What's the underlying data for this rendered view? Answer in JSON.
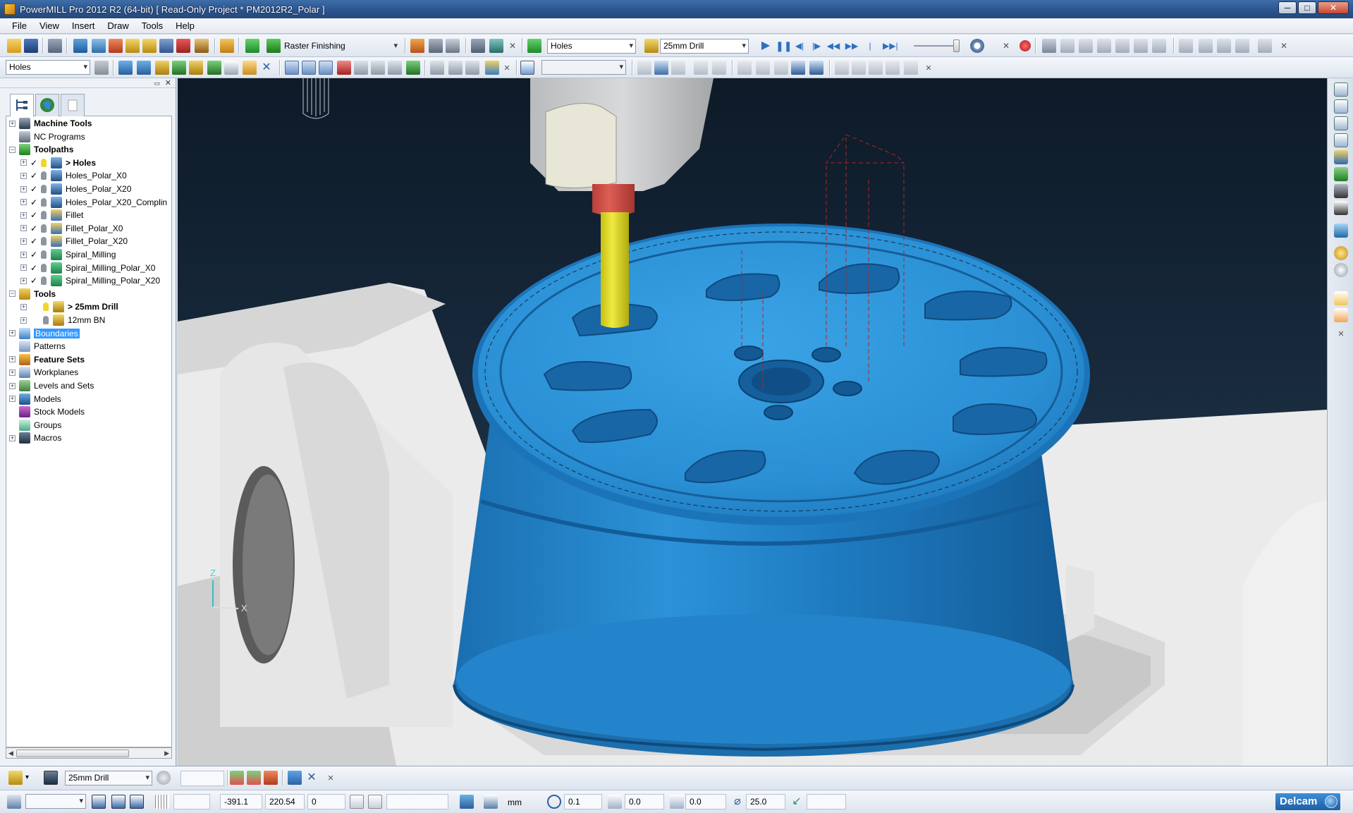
{
  "window": {
    "title": "PowerMILL Pro 2012 R2 (64-bit)    [ Read-Only Project * PM2012R2_Polar ]",
    "minimize": "─",
    "maximize": "□",
    "close": "✕"
  },
  "menu": {
    "items": [
      "File",
      "View",
      "Insert",
      "Draw",
      "Tools",
      "Help"
    ]
  },
  "toolbar1": {
    "strategy_combo": "Raster Finishing",
    "toolpath_combo": "Holes",
    "tool_combo": "25mm Drill"
  },
  "toolbar2": {
    "featureset_combo": "Holes",
    "empty_combo": ""
  },
  "explorer": {
    "tree": [
      {
        "label": "Machine Tools",
        "bold": true,
        "level": 0,
        "icon": "machine-tool-icon",
        "expander": "+"
      },
      {
        "label": "NC Programs",
        "bold": false,
        "level": 0,
        "icon": "nc-program-icon",
        "expander": ""
      },
      {
        "label": "Toolpaths",
        "bold": true,
        "level": 0,
        "icon": "toolpath-icon",
        "expander": "−"
      },
      {
        "label": "> Holes",
        "bold": true,
        "level": 1,
        "icon": "drill-toolpath-icon",
        "checked": "✓",
        "bulb": true,
        "expander": "+"
      },
      {
        "label": "Holes_Polar_X0",
        "bold": false,
        "level": 1,
        "icon": "drill-toolpath-icon",
        "checked": "✓",
        "bulb": false,
        "expander": "+"
      },
      {
        "label": "Holes_Polar_X20",
        "bold": false,
        "level": 1,
        "icon": "drill-toolpath-icon",
        "checked": "✓",
        "bulb": false,
        "expander": "+"
      },
      {
        "label": "Holes_Polar_X20_Complin",
        "bold": false,
        "level": 1,
        "icon": "drill-toolpath-icon",
        "checked": "✓",
        "bulb": false,
        "expander": "+"
      },
      {
        "label": "Fillet",
        "bold": false,
        "level": 1,
        "icon": "fillet-toolpath-icon",
        "checked": "✓",
        "bulb": false,
        "expander": "+"
      },
      {
        "label": "Fillet_Polar_X0",
        "bold": false,
        "level": 1,
        "icon": "fillet-toolpath-icon",
        "checked": "✓",
        "bulb": false,
        "expander": "+"
      },
      {
        "label": "Fillet_Polar_X20",
        "bold": false,
        "level": 1,
        "icon": "fillet-toolpath-icon",
        "checked": "✓",
        "bulb": false,
        "expander": "+"
      },
      {
        "label": "Spiral_Milling",
        "bold": false,
        "level": 1,
        "icon": "spiral-toolpath-icon",
        "checked": "✓",
        "bulb": false,
        "expander": "+"
      },
      {
        "label": "Spiral_Milling_Polar_X0",
        "bold": false,
        "level": 1,
        "icon": "spiral-toolpath-icon",
        "checked": "✓",
        "bulb": false,
        "expander": "+"
      },
      {
        "label": "Spiral_Milling_Polar_X20",
        "bold": false,
        "level": 1,
        "icon": "spiral-toolpath-icon",
        "checked": "✓",
        "bulb": false,
        "expander": "+"
      },
      {
        "label": "Tools",
        "bold": true,
        "level": 0,
        "icon": "tools-icon",
        "expander": "−"
      },
      {
        "label": "> 25mm Drill",
        "bold": true,
        "level": 2,
        "icon": "drill-tool-icon",
        "bulb": true,
        "expander": "+"
      },
      {
        "label": "12mm BN",
        "bold": false,
        "level": 2,
        "icon": "ballnose-tool-icon",
        "bulb": false,
        "expander": "+"
      },
      {
        "label": "Boundaries",
        "bold": false,
        "level": 0,
        "icon": "boundary-icon",
        "expander": "+",
        "selected": true
      },
      {
        "label": "Patterns",
        "bold": false,
        "level": 0,
        "icon": "pattern-icon",
        "expander": ""
      },
      {
        "label": "Feature Sets",
        "bold": true,
        "level": 0,
        "icon": "feature-set-icon",
        "expander": "+"
      },
      {
        "label": "Workplanes",
        "bold": false,
        "level": 0,
        "icon": "workplane-icon",
        "expander": "+"
      },
      {
        "label": "Levels and Sets",
        "bold": false,
        "level": 0,
        "icon": "levels-icon",
        "expander": "+"
      },
      {
        "label": "Models",
        "bold": false,
        "level": 0,
        "icon": "model-icon",
        "expander": "+"
      },
      {
        "label": "Stock Models",
        "bold": false,
        "level": 0,
        "icon": "stock-model-icon",
        "expander": ""
      },
      {
        "label": "Groups",
        "bold": false,
        "level": 0,
        "icon": "group-icon",
        "expander": ""
      },
      {
        "label": "Macros",
        "bold": false,
        "level": 0,
        "icon": "macro-icon",
        "expander": "+"
      }
    ]
  },
  "viewport": {
    "axis_z": "Z",
    "axis_x": "X",
    "colors": {
      "wheel": "#2a8fd4",
      "spindle": "#e8e6d6",
      "holder": "#d9534f",
      "drill": "#e8e030",
      "fixture": "#e9e9e9"
    }
  },
  "statusbar1": {
    "tool_combo": "25mm Drill"
  },
  "statusbar2": {
    "x": "-391.1",
    "y": "220.54",
    "z": "0",
    "units": "mm",
    "tolerance": "0.1",
    "thickness": "0.0",
    "tool_depth": "0.0",
    "diameter": "25.0",
    "brand": "Delcam"
  }
}
